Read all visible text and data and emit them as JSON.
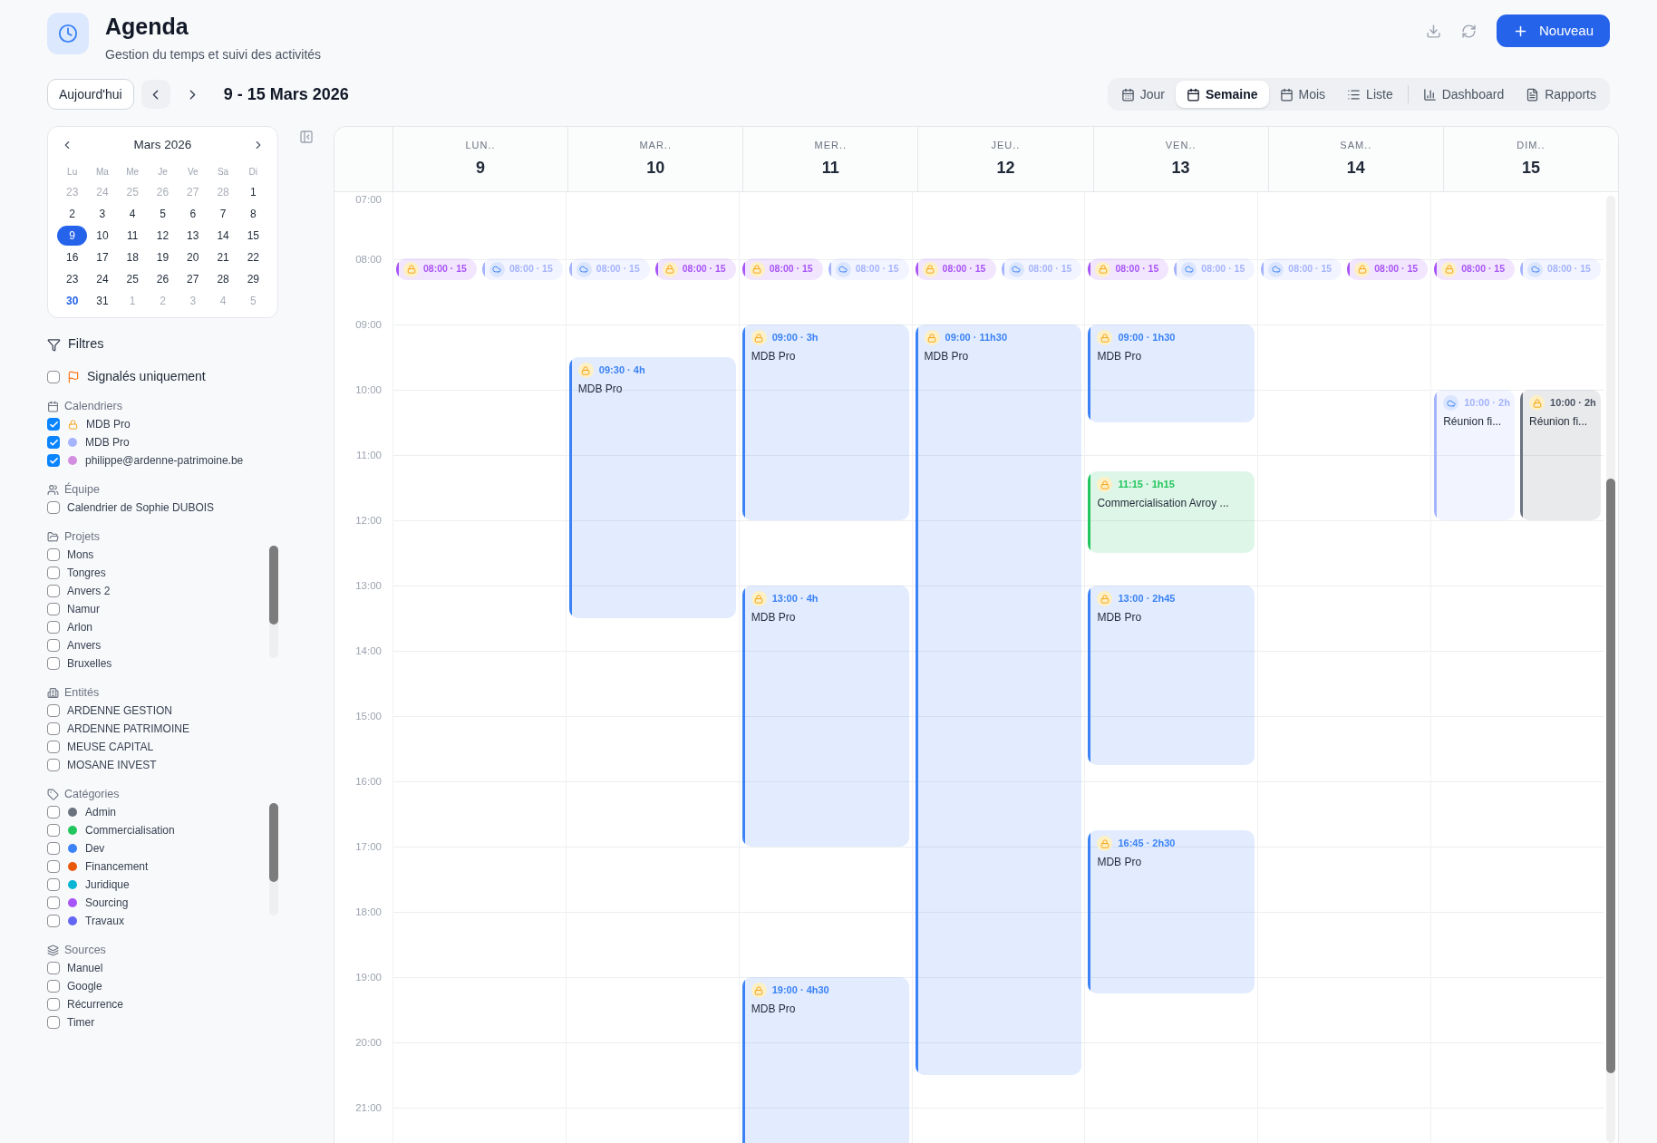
{
  "header": {
    "title": "Agenda",
    "subtitle": "Gestion du temps et suivi des activités",
    "new_button": "Nouveau"
  },
  "toolbar": {
    "today": "Aujourd'hui",
    "range": "9 - 15 Mars 2026",
    "views": [
      {
        "label": "Jour",
        "selected": false
      },
      {
        "label": "Semaine",
        "selected": true
      },
      {
        "label": "Mois",
        "selected": false
      },
      {
        "label": "Liste",
        "selected": false
      }
    ],
    "reports": [
      {
        "label": "Dashboard"
      },
      {
        "label": "Rapports"
      }
    ]
  },
  "mini_calendar": {
    "title": "Mars 2026",
    "weekdays": [
      "Lu",
      "Ma",
      "Me",
      "Je",
      "Ve",
      "Sa",
      "Di"
    ],
    "weeks": [
      [
        {
          "label": "23",
          "outside": true,
          "selected": false,
          "today": false
        },
        {
          "label": "24",
          "outside": true,
          "selected": false,
          "today": false
        },
        {
          "label": "25",
          "outside": true,
          "selected": false,
          "today": false
        },
        {
          "label": "26",
          "outside": true,
          "selected": false,
          "today": false
        },
        {
          "label": "27",
          "outside": true,
          "selected": false,
          "today": false
        },
        {
          "label": "28",
          "outside": true,
          "selected": false,
          "today": false
        },
        {
          "label": "1",
          "outside": false,
          "selected": false,
          "today": false
        }
      ],
      [
        {
          "label": "2",
          "outside": false,
          "selected": false,
          "today": false
        },
        {
          "label": "3",
          "outside": false,
          "selected": false,
          "today": false
        },
        {
          "label": "4",
          "outside": false,
          "selected": false,
          "today": false
        },
        {
          "label": "5",
          "outside": false,
          "selected": false,
          "today": false
        },
        {
          "label": "6",
          "outside": false,
          "selected": false,
          "today": false
        },
        {
          "label": "7",
          "outside": false,
          "selected": false,
          "today": false
        },
        {
          "label": "8",
          "outside": false,
          "selected": false,
          "today": false
        }
      ],
      [
        {
          "label": "9",
          "outside": false,
          "selected": true,
          "today": false
        },
        {
          "label": "10",
          "outside": false,
          "selected": false,
          "today": false
        },
        {
          "label": "11",
          "outside": false,
          "selected": false,
          "today": false
        },
        {
          "label": "12",
          "outside": false,
          "selected": false,
          "today": false
        },
        {
          "label": "13",
          "outside": false,
          "selected": false,
          "today": false
        },
        {
          "label": "14",
          "outside": false,
          "selected": false,
          "today": false
        },
        {
          "label": "15",
          "outside": false,
          "selected": false,
          "today": false
        }
      ],
      [
        {
          "label": "16",
          "outside": false,
          "selected": false,
          "today": false
        },
        {
          "label": "17",
          "outside": false,
          "selected": false,
          "today": false
        },
        {
          "label": "18",
          "outside": false,
          "selected": false,
          "today": false
        },
        {
          "label": "19",
          "outside": false,
          "selected": false,
          "today": false
        },
        {
          "label": "20",
          "outside": false,
          "selected": false,
          "today": false
        },
        {
          "label": "21",
          "outside": false,
          "selected": false,
          "today": false
        },
        {
          "label": "22",
          "outside": false,
          "selected": false,
          "today": false
        }
      ],
      [
        {
          "label": "23",
          "outside": false,
          "selected": false,
          "today": false
        },
        {
          "label": "24",
          "outside": false,
          "selected": false,
          "today": false
        },
        {
          "label": "25",
          "outside": false,
          "selected": false,
          "today": false
        },
        {
          "label": "26",
          "outside": false,
          "selected": false,
          "today": false
        },
        {
          "label": "27",
          "outside": false,
          "selected": false,
          "today": false
        },
        {
          "label": "28",
          "outside": false,
          "selected": false,
          "today": false
        },
        {
          "label": "29",
          "outside": false,
          "selected": false,
          "today": false
        }
      ],
      [
        {
          "label": "30",
          "outside": false,
          "selected": false,
          "today": true
        },
        {
          "label": "31",
          "outside": false,
          "selected": false,
          "today": false
        },
        {
          "label": "1",
          "outside": true,
          "selected": false,
          "today": false
        },
        {
          "label": "2",
          "outside": true,
          "selected": false,
          "today": false
        },
        {
          "label": "3",
          "outside": true,
          "selected": false,
          "today": false
        },
        {
          "label": "4",
          "outside": true,
          "selected": false,
          "today": false
        },
        {
          "label": "5",
          "outside": true,
          "selected": false,
          "today": false
        }
      ]
    ]
  },
  "filters": {
    "title": "Filtres",
    "flagged": {
      "label": "Signalés uniquement",
      "checked": false
    },
    "sections": [
      {
        "title": "Calendriers",
        "items": [
          {
            "label": "MDB Pro",
            "checked": true,
            "kind": "lock"
          },
          {
            "label": "MDB Pro",
            "checked": true,
            "kind": "dot",
            "color": "#a5b4fc"
          },
          {
            "label": "philippe@ardenne-patrimoine.be",
            "checked": true,
            "kind": "dot",
            "color": "#d38ee0"
          }
        ]
      },
      {
        "title": "Équipe",
        "items": [
          {
            "label": "Calendrier de Sophie DUBOIS",
            "checked": false,
            "kind": "plain"
          }
        ]
      },
      {
        "title": "Projets",
        "items": [
          {
            "label": "Mons",
            "checked": false,
            "kind": "plain"
          },
          {
            "label": "Tongres",
            "checked": false,
            "kind": "plain"
          },
          {
            "label": "Anvers 2",
            "checked": false,
            "kind": "plain"
          },
          {
            "label": "Namur",
            "checked": false,
            "kind": "plain"
          },
          {
            "label": "Arlon",
            "checked": false,
            "kind": "plain"
          },
          {
            "label": "Anvers",
            "checked": false,
            "kind": "plain"
          },
          {
            "label": "Bruxelles",
            "checked": false,
            "kind": "plain"
          }
        ]
      },
      {
        "title": "Entités",
        "items": [
          {
            "label": "ARDENNE GESTION",
            "checked": false,
            "kind": "plain"
          },
          {
            "label": "ARDENNE PATRIMOINE",
            "checked": false,
            "kind": "plain"
          },
          {
            "label": "MEUSE CAPITAL",
            "checked": false,
            "kind": "plain"
          },
          {
            "label": "MOSANE INVEST",
            "checked": false,
            "kind": "plain"
          }
        ]
      },
      {
        "title": "Catégories",
        "items": [
          {
            "label": "Admin",
            "checked": false,
            "kind": "dot",
            "color": "#6b7280"
          },
          {
            "label": "Commercialisation",
            "checked": false,
            "kind": "dot",
            "color": "#22c55e"
          },
          {
            "label": "Dev",
            "checked": false,
            "kind": "dot",
            "color": "#3b82f6"
          },
          {
            "label": "Financement",
            "checked": false,
            "kind": "dot",
            "color": "#ea580c"
          },
          {
            "label": "Juridique",
            "checked": false,
            "kind": "dot",
            "color": "#06b6d4"
          },
          {
            "label": "Sourcing",
            "checked": false,
            "kind": "dot",
            "color": "#a855f7"
          },
          {
            "label": "Travaux",
            "checked": false,
            "kind": "dot",
            "color": "#6366f1"
          }
        ]
      },
      {
        "title": "Sources",
        "items": [
          {
            "label": "Manuel",
            "checked": false,
            "kind": "plain"
          },
          {
            "label": "Google",
            "checked": false,
            "kind": "plain"
          },
          {
            "label": "Récurrence",
            "checked": false,
            "kind": "plain"
          },
          {
            "label": "Timer",
            "checked": false,
            "kind": "plain"
          }
        ]
      }
    ]
  },
  "week": {
    "hours": [
      "07:00",
      "08:00",
      "09:00",
      "10:00",
      "11:00",
      "12:00",
      "13:00",
      "14:00",
      "15:00",
      "16:00",
      "17:00",
      "18:00",
      "19:00",
      "20:00",
      "21:00"
    ],
    "days": [
      {
        "weekday": "LUN..",
        "date": "9",
        "events": [
          {
            "kind": "lock",
            "time": "08:00 · 15",
            "color": "#a855f7"
          },
          {
            "kind": "cloud",
            "time": "08:00 · 15",
            "color": "#a5b4fc"
          }
        ]
      },
      {
        "weekday": "MAR..",
        "date": "10",
        "events": [
          {
            "kind": "cloud",
            "time": "08:00 · 15",
            "color": "#a5b4fc"
          },
          {
            "kind": "lock",
            "time": "08:00 · 15",
            "color": "#a855f7"
          },
          {
            "kind": "lock",
            "time": "09:30 · 4h",
            "title": "MDB Pro",
            "color": "#3b82f6"
          }
        ]
      },
      {
        "weekday": "MER..",
        "date": "11",
        "events": [
          {
            "kind": "lock",
            "time": "08:00 · 15",
            "color": "#a855f7"
          },
          {
            "kind": "cloud",
            "time": "08:00 · 15",
            "color": "#a5b4fc"
          },
          {
            "kind": "lock",
            "time": "09:00 · 3h",
            "title": "MDB Pro",
            "color": "#3b82f6"
          },
          {
            "kind": "lock",
            "time": "13:00 · 4h",
            "title": "MDB Pro",
            "color": "#3b82f6"
          },
          {
            "kind": "lock",
            "time": "19:00 · 4h30",
            "title": "MDB Pro",
            "color": "#3b82f6"
          }
        ]
      },
      {
        "weekday": "JEU..",
        "date": "12",
        "events": [
          {
            "kind": "lock",
            "time": "08:00 · 15",
            "color": "#a855f7"
          },
          {
            "kind": "cloud",
            "time": "08:00 · 15",
            "color": "#a5b4fc"
          },
          {
            "kind": "lock",
            "time": "09:00 · 11h30",
            "title": "MDB Pro",
            "color": "#3b82f6"
          }
        ]
      },
      {
        "weekday": "VEN..",
        "date": "13",
        "events": [
          {
            "kind": "lock",
            "time": "08:00 · 15",
            "color": "#a855f7"
          },
          {
            "kind": "cloud",
            "time": "08:00 · 15",
            "color": "#a5b4fc"
          },
          {
            "kind": "lock",
            "time": "09:00 · 1h30",
            "title": "MDB Pro",
            "color": "#3b82f6"
          },
          {
            "kind": "lock",
            "time": "11:15 · 1h15",
            "title": "Commercialisation Avroy ...",
            "color": "#22c55e"
          },
          {
            "kind": "lock",
            "time": "13:00 · 2h45",
            "title": "MDB Pro",
            "color": "#3b82f6"
          },
          {
            "kind": "lock",
            "time": "16:45 · 2h30",
            "title": "MDB Pro",
            "color": "#3b82f6"
          }
        ]
      },
      {
        "weekday": "SAM..",
        "date": "14",
        "events": [
          {
            "kind": "cloud",
            "time": "08:00 · 15",
            "color": "#a5b4fc"
          },
          {
            "kind": "lock",
            "time": "08:00 · 15",
            "color": "#a855f7"
          }
        ]
      },
      {
        "weekday": "DIM..",
        "date": "15",
        "events": [
          {
            "kind": "lock",
            "time": "08:00 · 15",
            "color": "#a855f7"
          },
          {
            "kind": "cloud",
            "time": "08:00 · 15",
            "color": "#a5b4fc"
          },
          {
            "kind": "cloud",
            "time": "10:00 · 2h",
            "title": "Réunion fi...",
            "color": "#a5b4fc"
          },
          {
            "kind": "lock",
            "time": "10:00 · 2h",
            "title": "Réunion fi...",
            "color": "#6b7280"
          }
        ]
      }
    ]
  }
}
